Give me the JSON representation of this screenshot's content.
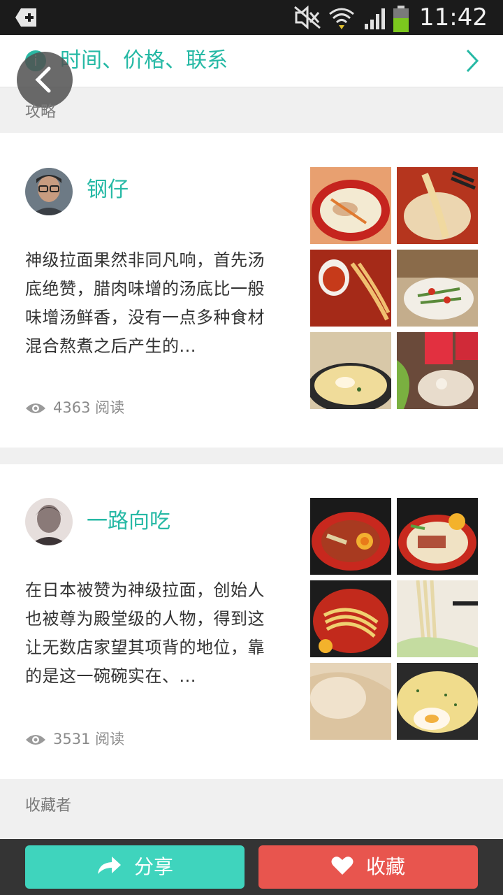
{
  "status_bar": {
    "time": "11:42"
  },
  "info_bar": {
    "text": "时间、价格、联系"
  },
  "sections": {
    "guides_label": "攻略",
    "collectors_label": "收藏者"
  },
  "posts": [
    {
      "author": "钢仔",
      "excerpt": "神级拉面果然非同凡响，首先汤底绝赞，腊肉味增的汤底比一般味增汤鲜香，没有一点多种食材混合熬煮之后产生的...",
      "reads": "4363 阅读"
    },
    {
      "author": "一路向吃",
      "excerpt": "在日本被赞为神级拉面，创始人也被尊为殿堂级的人物，得到这让无数店家望其项背的地位，靠的是这一碗碗实在、...",
      "reads": "3531 阅读"
    }
  ],
  "bottom_bar": {
    "share_label": "分享",
    "favorite_label": "收藏"
  },
  "colors": {
    "accent": "#26b9a5",
    "share": "#3fd4bd",
    "favorite": "#e8554e"
  }
}
